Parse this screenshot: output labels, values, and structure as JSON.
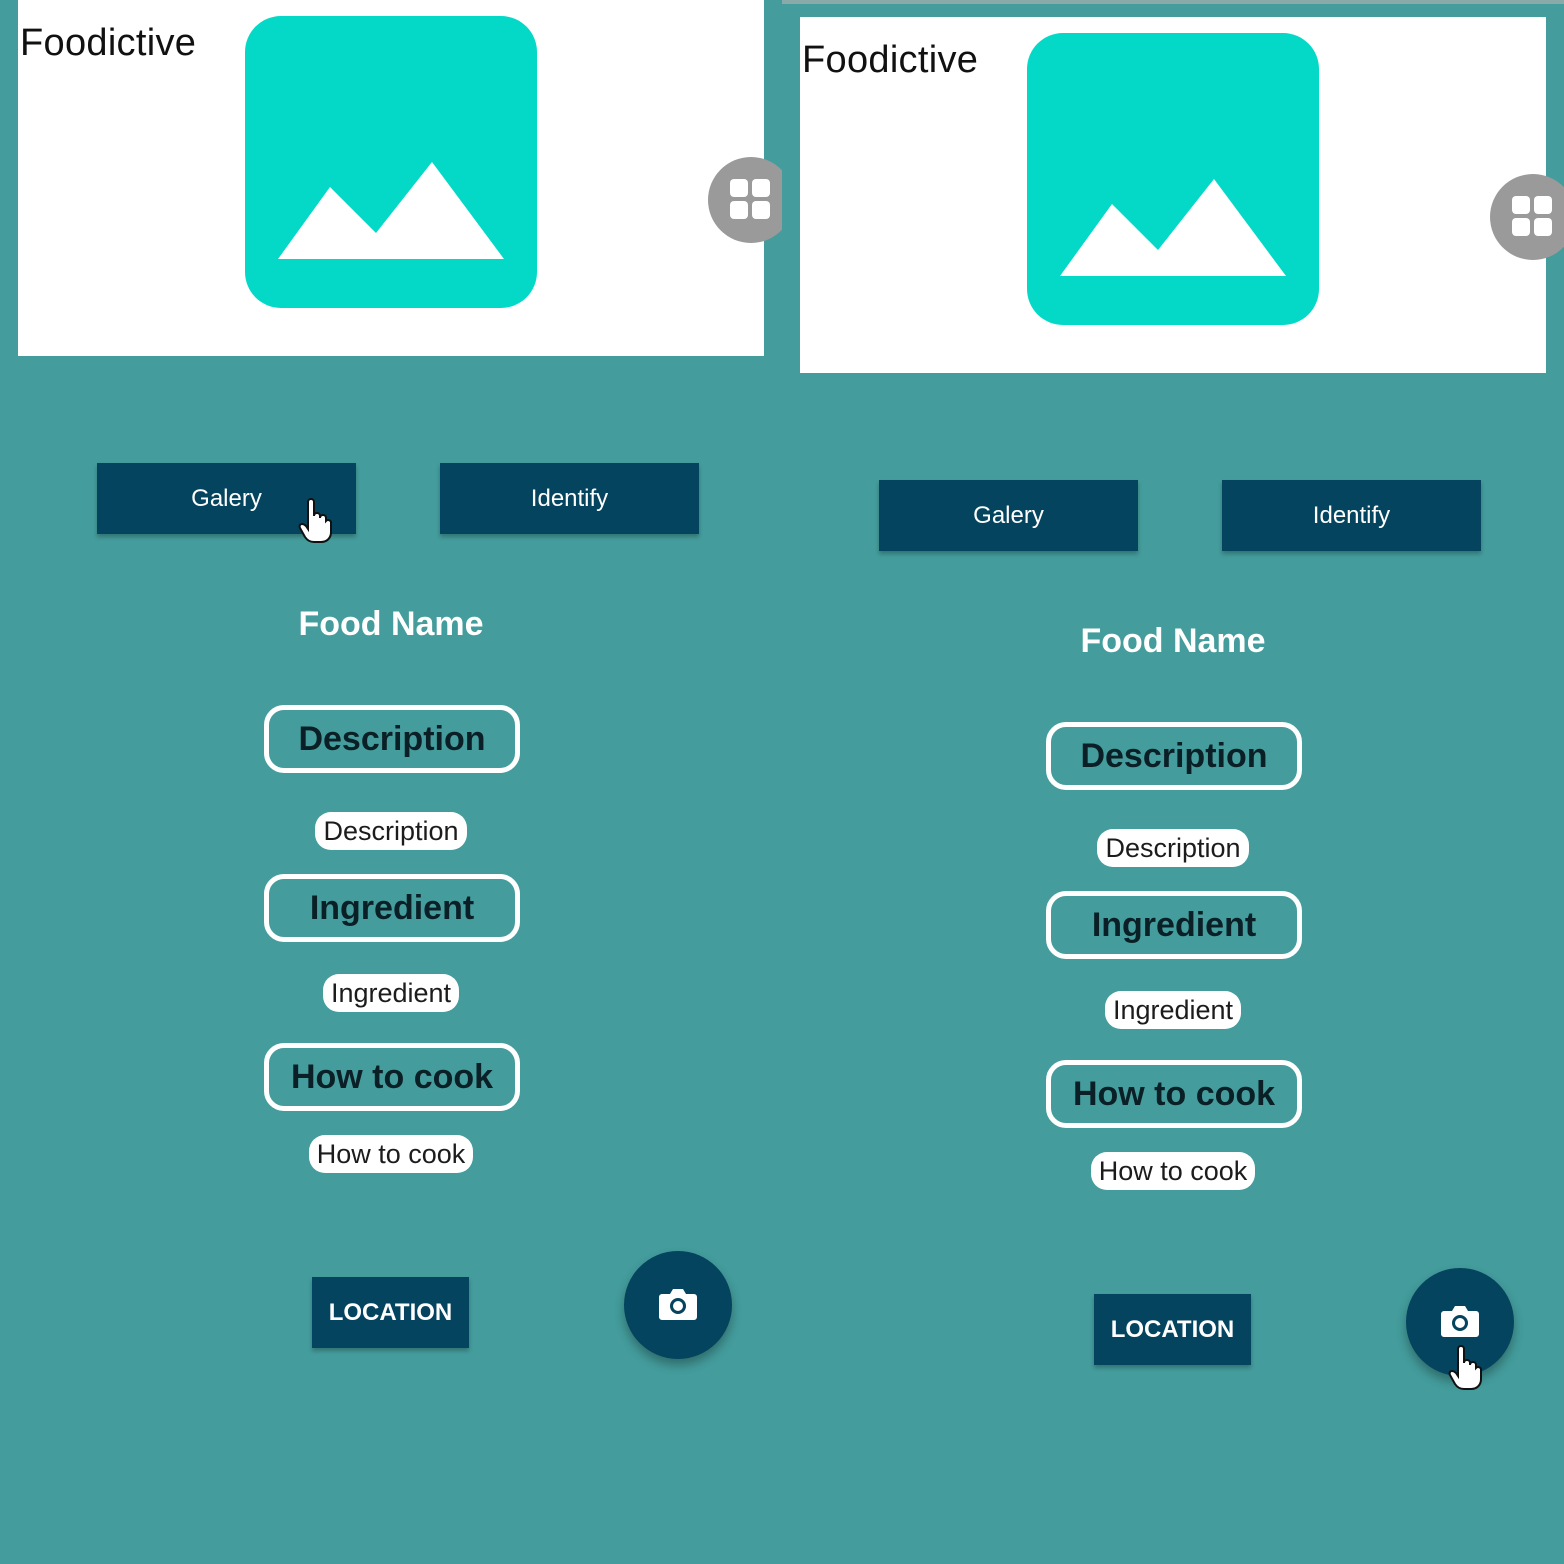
{
  "screens": [
    {
      "app_title": "Foodictive",
      "buttons": {
        "galery": "Galery",
        "identify": "Identify",
        "location": "LOCATION"
      },
      "food_name": "Food Name",
      "sections": {
        "description_heading": "Description",
        "description_text": "Description",
        "ingredient_heading": "Ingredient",
        "ingredient_text": "Ingredient",
        "how_to_cook_heading": "How to cook",
        "how_to_cook_text": "How to cook"
      }
    },
    {
      "app_title": "Foodictive",
      "buttons": {
        "galery": "Galery",
        "identify": "Identify",
        "location": "LOCATION"
      },
      "food_name": "Food Name",
      "sections": {
        "description_heading": "Description",
        "description_text": "Description",
        "ingredient_heading": "Ingredient",
        "ingredient_text": "Ingredient",
        "how_to_cook_heading": "How to cook",
        "how_to_cook_text": "How to cook"
      }
    }
  ],
  "icons": {
    "image_placeholder": "image-icon",
    "grid": "grid-icon",
    "camera": "camera-icon",
    "cursor": "hand-pointer-icon"
  },
  "colors": {
    "background": "#449c9c",
    "primary_dark": "#04445e",
    "accent_teal": "#04d9c8",
    "header_white": "#ffffff"
  }
}
